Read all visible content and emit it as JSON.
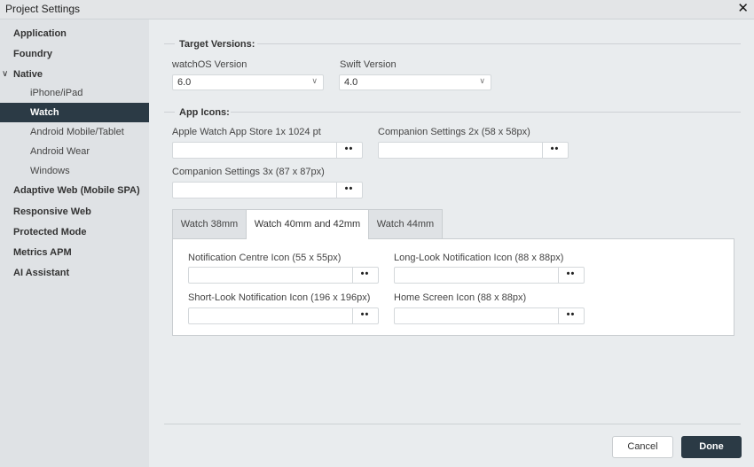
{
  "window": {
    "title": "Project Settings"
  },
  "sidebar": {
    "items": [
      {
        "label": "Application"
      },
      {
        "label": "Foundry"
      },
      {
        "label": "Native"
      },
      {
        "label": "iPhone/iPad"
      },
      {
        "label": "Watch"
      },
      {
        "label": "Android Mobile/Tablet"
      },
      {
        "label": "Android Wear"
      },
      {
        "label": "Windows"
      },
      {
        "label": "Adaptive Web (Mobile SPA)"
      },
      {
        "label": "Responsive Web"
      },
      {
        "label": "Protected Mode"
      },
      {
        "label": "Metrics APM"
      },
      {
        "label": "AI Assistant"
      }
    ],
    "active": "Watch"
  },
  "target_versions": {
    "title": "Target Versions:",
    "watchos": {
      "label": "watchOS Version",
      "value": "6.0"
    },
    "swift": {
      "label": "Swift Version",
      "value": "4.0"
    }
  },
  "app_icons": {
    "title": "App Icons:",
    "fields": [
      {
        "label": "Apple Watch App Store 1x 1024 pt"
      },
      {
        "label": "Companion Settings 2x (58 x 58px)"
      },
      {
        "label": "Companion Settings 3x (87 x 87px)"
      }
    ],
    "browse_label": "••"
  },
  "tabs": [
    {
      "label": "Watch 38mm"
    },
    {
      "label": "Watch 40mm and 42mm"
    },
    {
      "label": "Watch 44mm"
    }
  ],
  "active_tab": "Watch 40mm and 42mm",
  "tab_fields": [
    {
      "label": "Notification Centre Icon (55 x 55px)"
    },
    {
      "label": "Long-Look Notification Icon (88 x 88px)"
    },
    {
      "label": "Short-Look Notification Icon (196 x 196px)"
    },
    {
      "label": "Home Screen Icon (88 x 88px)"
    }
  ],
  "footer": {
    "cancel_label": "Cancel",
    "done_label": "Done"
  },
  "colors": {
    "accent": "#2b3a45",
    "sidebar_bg": "#dfe2e5",
    "content_bg": "#e9ecee"
  }
}
